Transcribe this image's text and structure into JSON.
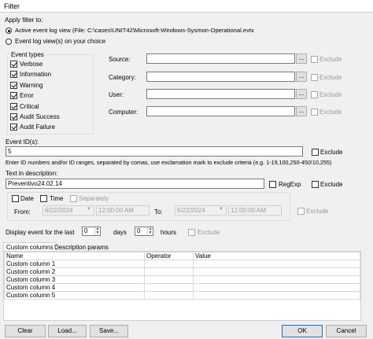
{
  "window": {
    "title": "Filter"
  },
  "apply_filter": {
    "label": "Apply filter to:",
    "active_log": "Active event log view (File: C:\\cases\\UNIT42\\Microsoft-Windows-Sysmon-Operational.evtx",
    "choice_log": "Event log view(s) on your choice"
  },
  "event_types": {
    "label": "Event types",
    "items": [
      "Verbose",
      "Information",
      "Warning",
      "Error",
      "Critical",
      "Audit Success",
      "Audit Failure"
    ]
  },
  "fields": {
    "source": "Source:",
    "category": "Category:",
    "user": "User:",
    "computer": "Computer:",
    "browse": "...",
    "exclude": "Exclude"
  },
  "event_ids": {
    "label": "Event ID(s):",
    "value": "5",
    "exclude": "Exclude",
    "hint": "Enter ID numbers and/or ID ranges, separated by comas, use exclamation mark to exclude criteria (e.g. 1-19,100,250-450!10,255)"
  },
  "description": {
    "label": "Text in description:",
    "value": "Preventivo24.02.14",
    "regexp": "RegExp",
    "exclude": "Exclude"
  },
  "date_time": {
    "date": "Date",
    "time": "Time",
    "separately": "Separately",
    "from": "From:",
    "to": "To:",
    "from_date": "6/22/2024",
    "from_time": "12:00:00 AM",
    "to_date": "6/22/2024",
    "to_time": "12:00:00 AM",
    "exclude": "Exclude"
  },
  "last": {
    "label": "Display event for the last",
    "days_value": "0",
    "days": "days",
    "hours_value": "0",
    "hours": "hours",
    "exclude": "Exclude"
  },
  "tabs": [
    "Custom columns",
    "Description params"
  ],
  "custom_columns": {
    "headers": [
      "Name",
      "Operator",
      "Value"
    ],
    "rows": [
      [
        "Custom column 1",
        "",
        ""
      ],
      [
        "Custom column 2",
        "",
        ""
      ],
      [
        "Custom column 3",
        "",
        ""
      ],
      [
        "Custom column 4",
        "",
        ""
      ],
      [
        "Custom column 5",
        "",
        ""
      ]
    ]
  },
  "buttons": {
    "clear": "Clear",
    "load": "Load...",
    "save": "Save...",
    "ok": "OK",
    "cancel": "Cancel"
  },
  "colors": {
    "window_bg": "#f0f0f0",
    "button_bg": "#e1e1e1",
    "default_border": "#0078d7"
  }
}
